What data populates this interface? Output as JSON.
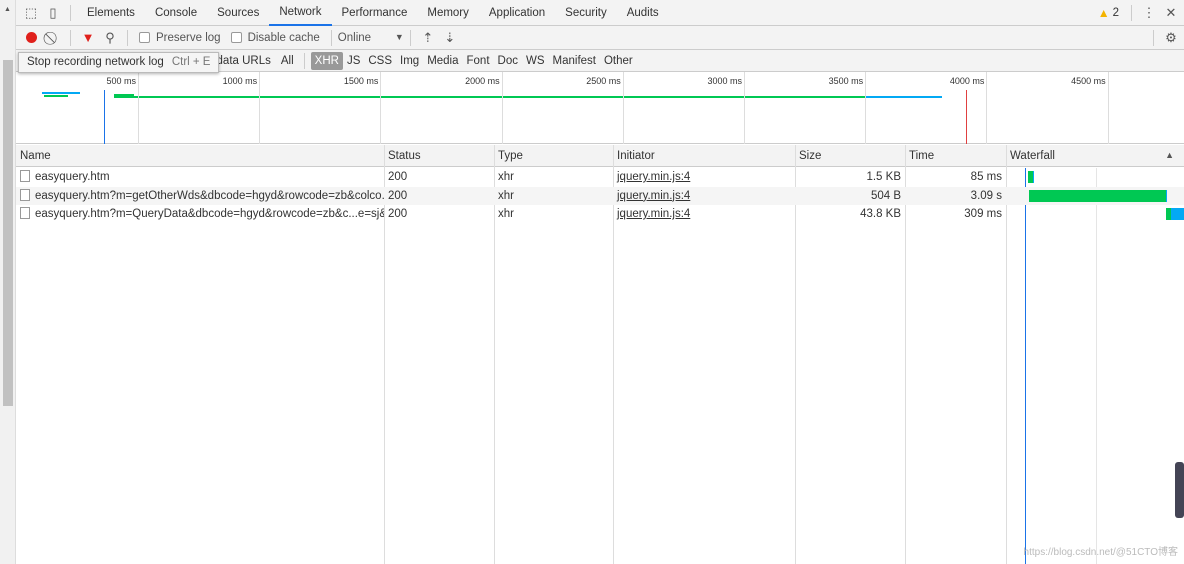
{
  "tabs": [
    "Elements",
    "Console",
    "Sources",
    "Network",
    "Performance",
    "Memory",
    "Application",
    "Security",
    "Audits"
  ],
  "active_tab": "Network",
  "warnings_count": "2",
  "toolbar": {
    "preserve_log": "Preserve log",
    "disable_cache": "Disable cache",
    "throttle": "Online"
  },
  "tooltip": {
    "text": "Stop recording network log",
    "shortcut": "Ctrl + E"
  },
  "filter": {
    "hide_data_urls": "ide data URLs",
    "types": [
      "All",
      "XHR",
      "JS",
      "CSS",
      "Img",
      "Media",
      "Font",
      "Doc",
      "WS",
      "Manifest",
      "Other"
    ],
    "active": "XHR"
  },
  "overview_ticks": [
    "500 ms",
    "1000 ms",
    "1500 ms",
    "2000 ms",
    "2500 ms",
    "3000 ms",
    "3500 ms",
    "4000 ms",
    "4500 ms"
  ],
  "columns": [
    "Name",
    "Status",
    "Type",
    "Initiator",
    "Size",
    "Time",
    "Waterfall"
  ],
  "rows": [
    {
      "name": "easyquery.htm",
      "status": "200",
      "type": "xhr",
      "initiator": "jquery.min.js:4",
      "size": "1.5 KB",
      "time": "85 ms"
    },
    {
      "name": "easyquery.htm?m=getOtherWds&dbcode=hgyd&rowcode=zb&colco...",
      "status": "200",
      "type": "xhr",
      "initiator": "jquery.min.js:4",
      "size": "504 B",
      "time": "3.09 s"
    },
    {
      "name": "easyquery.htm?m=QueryData&dbcode=hgyd&rowcode=zb&c...e=sj&...",
      "status": "200",
      "type": "xhr",
      "initiator": "jquery.min.js:4",
      "size": "43.8 KB",
      "time": "309 ms"
    }
  ],
  "colors": {
    "accent": "#1a73e8",
    "record": "#e0201b",
    "waiting": "#00c853",
    "download": "#03a9f4",
    "load_line": "#e04040",
    "dom_line": "#1a73e8"
  },
  "watermark": "https://blog.csdn.net/@51CTO博客"
}
